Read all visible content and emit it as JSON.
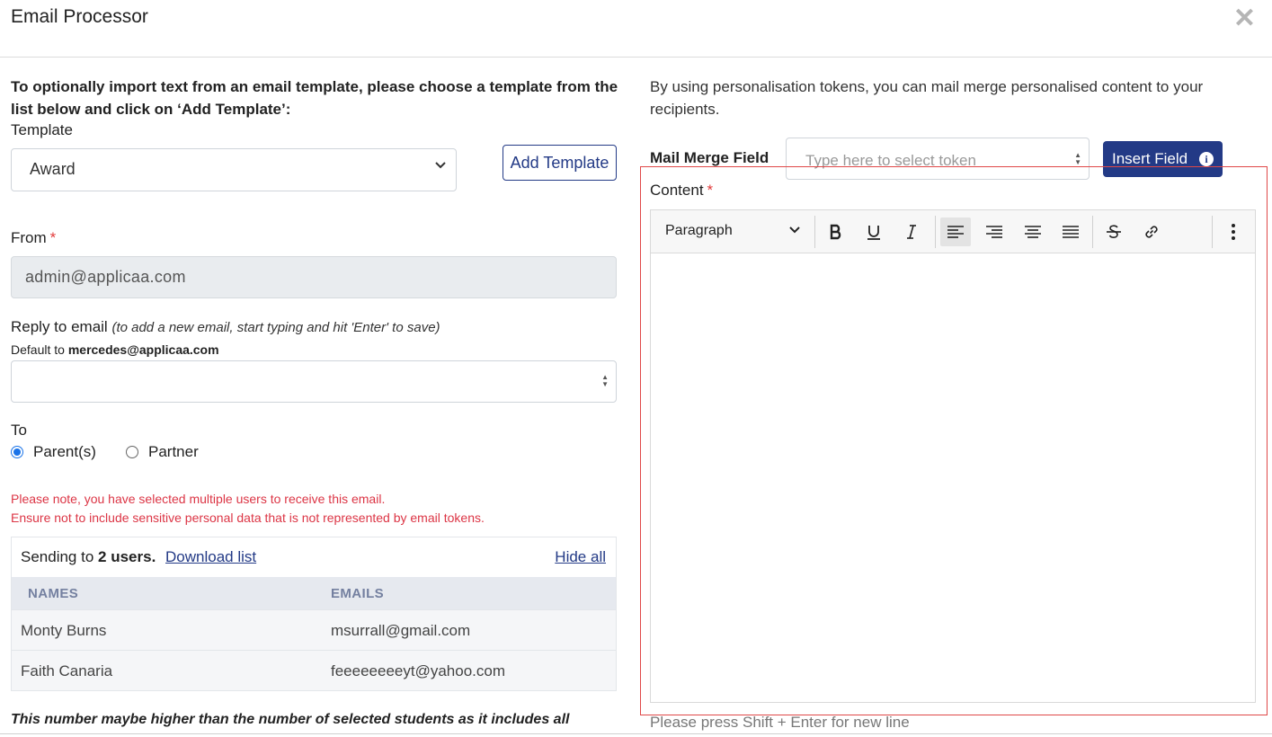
{
  "header": {
    "title": "Email Processor"
  },
  "template": {
    "intro": "To optionally import text from an email template, please choose a template from the list below and click on ‘Add Template’:",
    "label": "Template",
    "selected": "Award",
    "add_button": "Add Template"
  },
  "from": {
    "label": "From",
    "required_mark": "*",
    "value": "admin@applicaa.com"
  },
  "reply": {
    "label": "Reply to email",
    "hint": "(to add a new email, start typing and hit 'Enter' to save)",
    "default_prefix": "Default to",
    "default_email": "mercedes@applicaa.com"
  },
  "to": {
    "label": "To",
    "options": [
      {
        "label": "Parent(s)",
        "checked": true
      },
      {
        "label": "Partner",
        "checked": false
      }
    ]
  },
  "warnings": [
    "Please note, you have selected multiple users to receive this email.",
    "Ensure not to include sensitive personal data that is not represented by email tokens."
  ],
  "sending": {
    "prefix": "Sending to",
    "count": "2 users.",
    "download": "Download list",
    "hide": "Hide all",
    "columns": [
      "NAMES",
      "EMAILS"
    ],
    "rows": [
      {
        "name": "Monty Burns",
        "email": "msurrall@gmail.com"
      },
      {
        "name": "Faith Canaria",
        "email": "feeeeeeeeyt@yahoo.com"
      }
    ]
  },
  "note": "This number maybe higher than the number of selected students as it includes all",
  "merge": {
    "intro": "By using personalisation tokens, you can mail merge personalised content to your recipients.",
    "label": "Mail Merge Field",
    "placeholder": "Type here to select token",
    "button": "Insert Field",
    "info_glyph": "i"
  },
  "content": {
    "label": "Content",
    "required_mark": "*",
    "format": "Paragraph",
    "hint": "Please press Shift + Enter for new line"
  },
  "close_glyph": "✕"
}
